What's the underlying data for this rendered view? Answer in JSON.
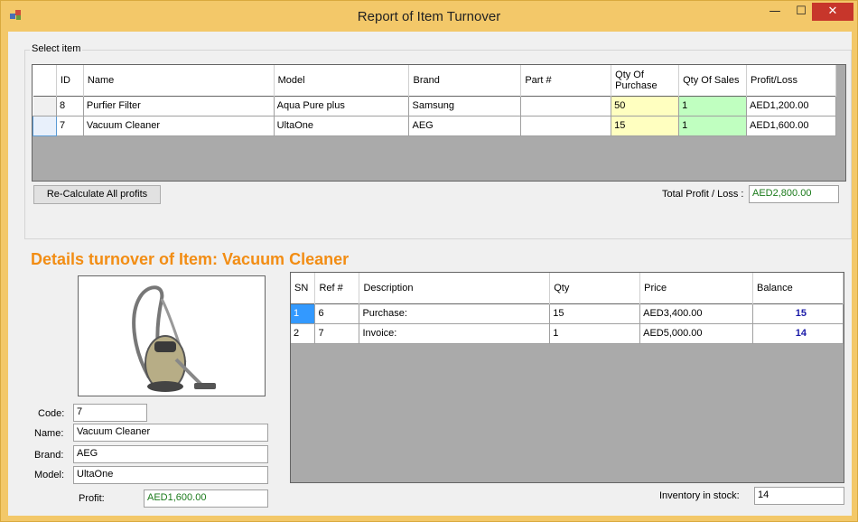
{
  "window": {
    "title": "Report of Item Turnover",
    "minimize": "—",
    "maximize": "☐",
    "close": "✕"
  },
  "select_item": {
    "group_label": "Select item",
    "columns": [
      "ID",
      "Name",
      "Model",
      "Brand",
      "Part #",
      "Qty Of Purchase",
      "Qty Of Sales",
      "Profit/Loss"
    ],
    "rows": [
      {
        "id": "8",
        "name": "Purfier Filter",
        "model": "Aqua Pure plus",
        "brand": "Samsung",
        "part": "",
        "qty_purchase": "50",
        "qty_sales": "1",
        "profit": "AED1,200.00"
      },
      {
        "id": "7",
        "name": "Vacuum Cleaner",
        "model": "UltaOne",
        "brand": "AEG",
        "part": "",
        "qty_purchase": "15",
        "qty_sales": "1",
        "profit": "AED1,600.00"
      }
    ],
    "recalc_button": "Re-Calculate All profits",
    "total_label": "Total Profit / Loss :",
    "total_value": "AED2,800.00"
  },
  "details": {
    "title": "Details  turnover of Item: Vacuum Cleaner",
    "code_label": "Code:",
    "code_value": "7",
    "name_label": "Name:",
    "name_value": "Vacuum Cleaner",
    "brand_label": "Brand:",
    "brand_value": "AEG",
    "model_label": "Model:",
    "model_value": "UltaOne",
    "profit_label": "Profit:",
    "profit_value": "AED1,600.00",
    "columns": [
      "SN",
      "Ref #",
      "Description",
      "Qty",
      "Price",
      "Balance"
    ],
    "rows": [
      {
        "sn": "1",
        "ref": "6",
        "description": "Purchase:",
        "qty": "15",
        "price": "AED3,400.00",
        "balance": "15"
      },
      {
        "sn": "2",
        "ref": "7",
        "description": "Invoice:",
        "qty": "1",
        "price": "AED5,000.00",
        "balance": "14"
      }
    ],
    "stock_label": "Inventory in stock:",
    "stock_value": "14"
  }
}
